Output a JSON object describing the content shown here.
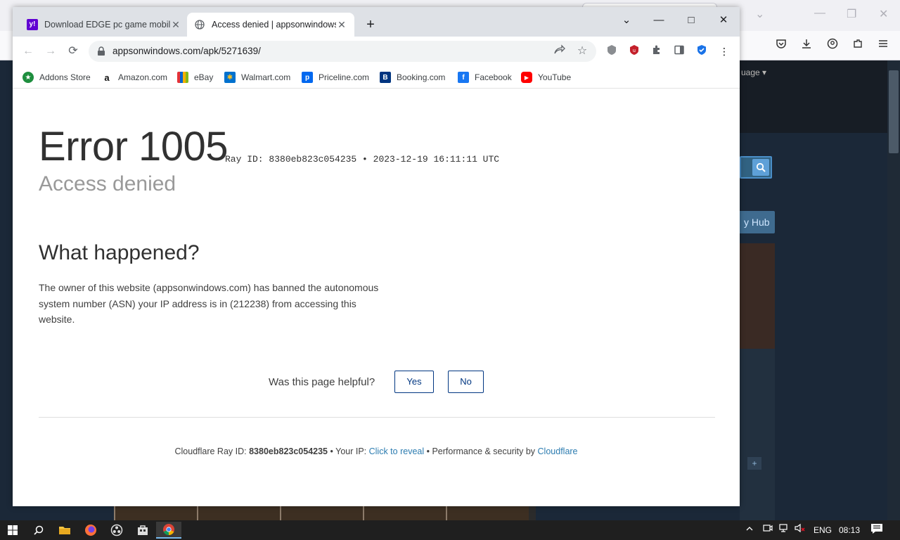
{
  "background_window": {
    "language_label": "uage ▾",
    "hub_label": "y Hub",
    "plus_label": "+"
  },
  "tabs": [
    {
      "title": "Download EDGE pc game mobile",
      "favicon": "yahoo-icon",
      "close": "✕"
    },
    {
      "title": "Access denied | appsonwindows",
      "favicon": "globe-icon",
      "close": "✕"
    }
  ],
  "new_tab_label": "+",
  "window_controls": {
    "tabsearch": "⌄",
    "minimize": "—",
    "maximize": "□",
    "close": "✕"
  },
  "address_bar": {
    "url": "appsonwindows.com/apk/5271639/"
  },
  "bookmarks": [
    {
      "label": "Addons Store",
      "icon": "addons-store-icon",
      "color": "#1e8e3e",
      "glyph": "★"
    },
    {
      "label": "Amazon.com",
      "icon": "amazon-icon",
      "color": "#ffffff",
      "glyph": "a"
    },
    {
      "label": "eBay",
      "icon": "ebay-icon",
      "color": "#e53238",
      "glyph": "e"
    },
    {
      "label": "Walmart.com",
      "icon": "walmart-icon",
      "color": "#0071ce",
      "glyph": "✱"
    },
    {
      "label": "Priceline.com",
      "icon": "priceline-icon",
      "color": "#0068ef",
      "glyph": "p"
    },
    {
      "label": "Booking.com",
      "icon": "booking-icon",
      "color": "#003580",
      "glyph": "B"
    },
    {
      "label": "Facebook",
      "icon": "facebook-icon",
      "color": "#1877f2",
      "glyph": "f"
    },
    {
      "label": "YouTube",
      "icon": "youtube-icon",
      "color": "#ff0000",
      "glyph": "▶"
    }
  ],
  "page": {
    "error_title": "Error 1005",
    "ray_label": "Ray ID: 8380eb823c054235 •",
    "timestamp": "2023-12-19 16:11:11 UTC",
    "subtitle": "Access denied",
    "section_heading": "What happened?",
    "explanation": "The owner of this website (appsonwindows.com) has banned the autonomous system number (ASN) your IP address is in (212238) from accessing this website.",
    "helpful_question": "Was this page helpful?",
    "yes_label": "Yes",
    "no_label": "No",
    "footer": {
      "ray_prefix": "Cloudflare Ray ID:",
      "ray_id": "8380eb823c054235",
      "ip_prefix": "• Your IP:",
      "reveal_link": "Click to reveal",
      "perf_text": "• Performance & security by",
      "cloudflare_link": "Cloudflare"
    }
  },
  "taskbar": {
    "apps": [
      "start-icon",
      "search-icon",
      "file-explorer-icon",
      "firefox-icon",
      "obs-icon",
      "store-icon",
      "chrome-icon"
    ],
    "language": "ENG",
    "time": "08:13"
  },
  "colors": {
    "cloudflare_link": "#2c7cb0",
    "button_border": "#003681",
    "taskbar": "#1f1f1f"
  }
}
